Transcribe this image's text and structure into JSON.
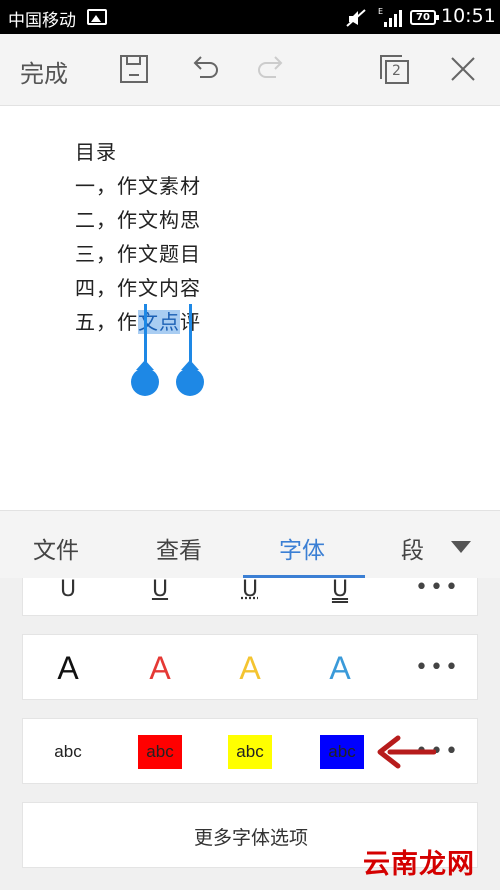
{
  "status_bar": {
    "carrier": "中国移动",
    "network": "E",
    "battery": "70",
    "time": "10:51"
  },
  "toolbar": {
    "done_label": "完成",
    "page_count": "2"
  },
  "document": {
    "lines": [
      "目录",
      "一，作文素材",
      "二，作文构思",
      "三，作文题目",
      "四，作文内容"
    ],
    "last_line": {
      "before": "五，作",
      "selected": "文点",
      "after": "评"
    }
  },
  "tabs": [
    {
      "label": "文件"
    },
    {
      "label": "查看"
    },
    {
      "label": "字体",
      "active": true
    },
    {
      "label": "段"
    }
  ],
  "font_panel": {
    "underline_row": {
      "options": [
        "U",
        "U",
        "U",
        "U"
      ],
      "more": "•••"
    },
    "color_row": {
      "glyph": "A",
      "colors": [
        "#111111",
        "#e53935",
        "#f4c430",
        "#3a9ad9"
      ],
      "more": "•••"
    },
    "highlight_row": {
      "text": "abc",
      "highlights": [
        "none",
        "#ff0000",
        "#ffff00",
        "#0000ff"
      ],
      "more": "•••"
    },
    "more_options_label": "更多字体选项"
  },
  "colors": {
    "accent": "#3b7fd4",
    "selection_handle": "#1e88e5",
    "annotation_arrow": "#b71c1c"
  },
  "watermark": "云南龙网"
}
